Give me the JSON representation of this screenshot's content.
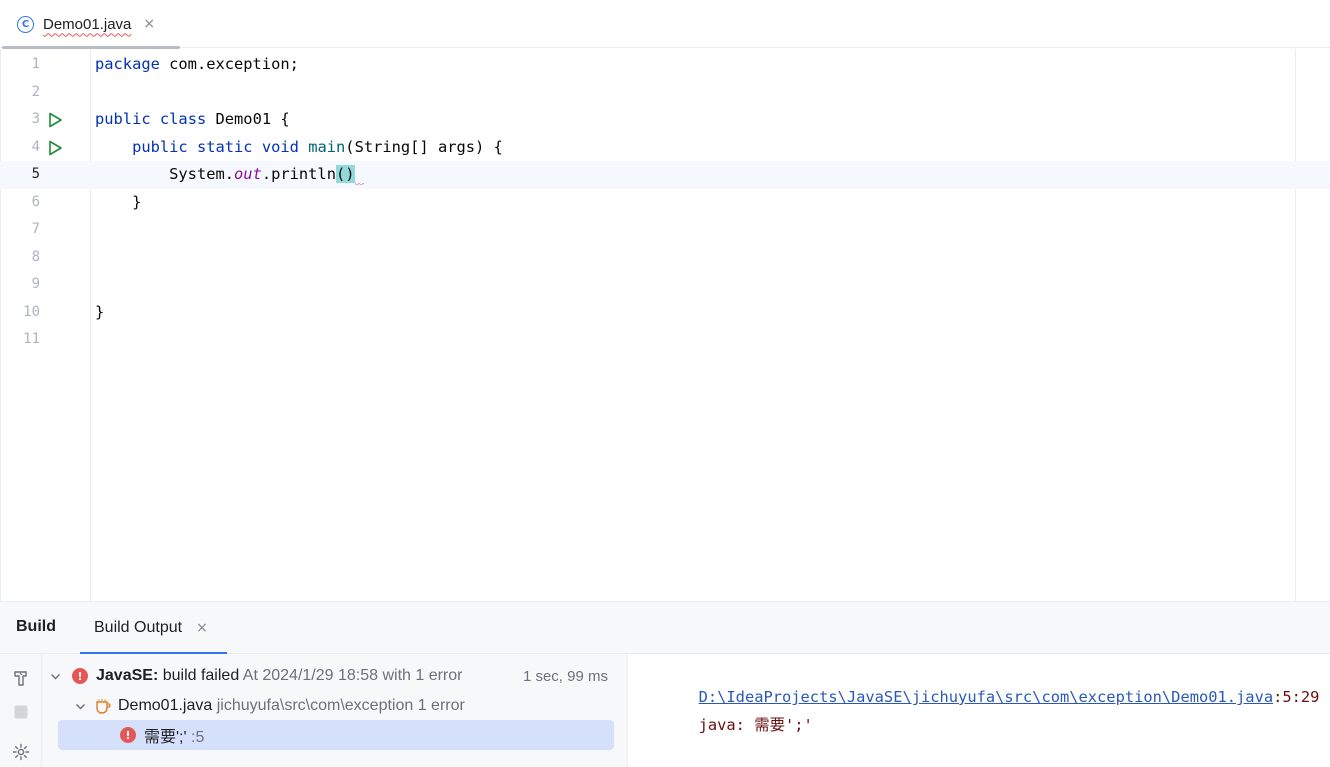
{
  "editor_tab": {
    "title": "Demo01.java",
    "close_glyph": "×",
    "icon": "class-icon"
  },
  "editor": {
    "current_line": 5,
    "lines": [
      {
        "num": "1"
      },
      {
        "num": "2"
      },
      {
        "num": "3"
      },
      {
        "num": "4"
      },
      {
        "num": "5"
      },
      {
        "num": "6"
      },
      {
        "num": "7"
      },
      {
        "num": "8"
      },
      {
        "num": "9"
      },
      {
        "num": "10"
      },
      {
        "num": "11"
      }
    ],
    "code": {
      "l1_kw": "package",
      "l1_rest": " com.exception;",
      "l3_kw1": "public",
      "l3_kw2": "class",
      "l3_rest": " Demo01 {",
      "l4_indent": "    ",
      "l4_kw1": "public",
      "l4_kw2": "static",
      "l4_kw3": "void",
      "l4_fn": "main",
      "l4_rest": "(String[] args) {",
      "l5_indent": "        ",
      "l5_a": "System.",
      "l5_static": "out",
      "l5_b": ".println",
      "l5_paren": "()",
      "l6": "    }",
      "l10": "}"
    }
  },
  "build_window": {
    "title": "Build",
    "tab_label": "Build Output",
    "tab_close": "×",
    "tree": {
      "root": {
        "project": "JavaSE:",
        "status": " build failed",
        "detail": " At 2024/1/29 18:58 with 1 error",
        "time": "1 sec, 99 ms"
      },
      "file": {
        "name": "Demo01.java",
        "path": " jichuyufa\\src\\com\\exception 1 error"
      },
      "error": {
        "message": "需要';'",
        "line": " :5"
      }
    },
    "console": {
      "link": "D:\\IdeaProjects\\JavaSE\\jichuyufa\\src\\com\\exception\\Demo01.java",
      "position": ":5:29",
      "message": "java: 需要';'"
    }
  },
  "colors": {
    "accent": "#3574f0",
    "error": "#e55757",
    "run": "#208a3c",
    "keyword": "#0033b3"
  }
}
